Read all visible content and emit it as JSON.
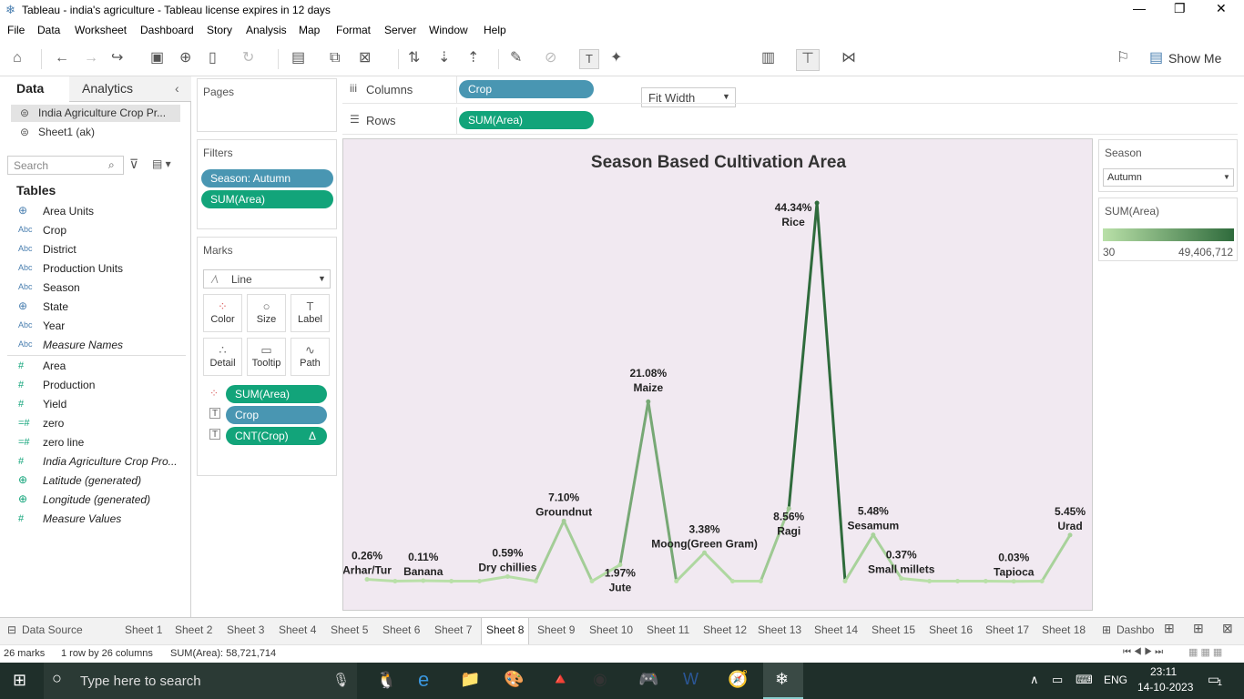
{
  "window": {
    "title": "Tableau - india's agriculture - Tableau license expires in 12 days"
  },
  "menu": [
    "File",
    "Data",
    "Worksheet",
    "Dashboard",
    "Story",
    "Analysis",
    "Map",
    "Format",
    "Server",
    "Window",
    "Help"
  ],
  "toolbar": {
    "fit": "Fit Width",
    "show_me": "Show Me"
  },
  "data_pane": {
    "tab_data": "Data",
    "tab_analytics": "Analytics",
    "sources": [
      "India Agriculture Crop Pr...",
      "Sheet1 (ak)"
    ],
    "search_placeholder": "Search",
    "tables_heading": "Tables",
    "fields": [
      {
        "type": "globe",
        "name": "Area Units"
      },
      {
        "type": "Abc",
        "name": "Crop"
      },
      {
        "type": "Abc",
        "name": "District"
      },
      {
        "type": "Abc",
        "name": "Production Units"
      },
      {
        "type": "Abc",
        "name": "Season"
      },
      {
        "type": "globe",
        "name": "State"
      },
      {
        "type": "Abc",
        "name": "Year"
      },
      {
        "type": "Abc",
        "name": "Measure Names"
      },
      {
        "type": "#",
        "name": "Area"
      },
      {
        "type": "#",
        "name": "Production"
      },
      {
        "type": "#",
        "name": "Yield"
      },
      {
        "type": "=#",
        "name": "zero"
      },
      {
        "type": "=#",
        "name": "zero line"
      },
      {
        "type": "#",
        "name": "India Agriculture Crop Pro..."
      },
      {
        "type": "globe",
        "name": "Latitude (generated)"
      },
      {
        "type": "globe",
        "name": "Longitude (generated)"
      },
      {
        "type": "#",
        "name": "Measure Values"
      }
    ]
  },
  "pages": {
    "title": "Pages"
  },
  "filters": {
    "title": "Filters",
    "items": [
      "Season: Autumn",
      "SUM(Area)"
    ]
  },
  "marks": {
    "title": "Marks",
    "type": "Line",
    "buttons": [
      "Color",
      "Size",
      "Label",
      "Detail",
      "Tooltip",
      "Path"
    ],
    "pills": [
      "SUM(Area)",
      "Crop",
      "CNT(Crop)"
    ],
    "delta": "Δ"
  },
  "shelves": {
    "columns_label": "Columns",
    "columns_pill": "Crop",
    "rows_label": "Rows",
    "rows_pill": "SUM(Area)"
  },
  "season_card": {
    "title": "Season",
    "value": "Autumn"
  },
  "legend": {
    "title": "SUM(Area)",
    "min": "30",
    "max": "49,406,712"
  },
  "chart_data": {
    "type": "line",
    "title": "Season Based Cultivation  Area",
    "points": [
      {
        "label": "Arhar/Tur",
        "pct": "0.26%",
        "value": 0.26
      },
      {
        "label": "",
        "pct": "",
        "value": 0.05
      },
      {
        "label": "Banana",
        "pct": "0.11%",
        "value": 0.11
      },
      {
        "label": "",
        "pct": "",
        "value": 0.05
      },
      {
        "label": "",
        "pct": "",
        "value": 0.05
      },
      {
        "label": "Dry chillies",
        "pct": "0.59%",
        "value": 0.59
      },
      {
        "label": "",
        "pct": "",
        "value": 0.05
      },
      {
        "label": "Groundnut",
        "pct": "7.10%",
        "value": 7.1
      },
      {
        "label": "",
        "pct": "",
        "value": 0.05
      },
      {
        "label": "Jute",
        "pct": "1.97%",
        "value": 1.97
      },
      {
        "label": "Maize",
        "pct": "21.08%",
        "value": 21.08
      },
      {
        "label": "",
        "pct": "",
        "value": 0.05
      },
      {
        "label": "Moong(Green Gram)",
        "pct": "3.38%",
        "value": 3.38
      },
      {
        "label": "",
        "pct": "",
        "value": 0.05
      },
      {
        "label": "",
        "pct": "",
        "value": 0.05
      },
      {
        "label": "Ragi",
        "pct": "8.56%",
        "value": 8.56
      },
      {
        "label": "Rice",
        "pct": "44.34%",
        "value": 44.34
      },
      {
        "label": "",
        "pct": "",
        "value": 0.05
      },
      {
        "label": "Sesamum",
        "pct": "5.48%",
        "value": 5.48
      },
      {
        "label": "Small millets",
        "pct": "0.37%",
        "value": 0.37
      },
      {
        "label": "",
        "pct": "",
        "value": 0.05
      },
      {
        "label": "",
        "pct": "",
        "value": 0.05
      },
      {
        "label": "",
        "pct": "",
        "value": 0.05
      },
      {
        "label": "Tapioca",
        "pct": "0.03%",
        "value": 0.03
      },
      {
        "label": "",
        "pct": "",
        "value": 0.05
      },
      {
        "label": "Urad",
        "pct": "5.45%",
        "value": 5.45
      }
    ]
  },
  "sheet_tabs": [
    "Data Source",
    "Sheet 1",
    "Sheet 2",
    "Sheet 3",
    "Sheet 4",
    "Sheet 5",
    "Sheet 6",
    "Sheet 7",
    "Sheet 8",
    "Sheet 9",
    "Sheet 10",
    "Sheet 11",
    "Sheet 12",
    "Sheet 13",
    "Sheet 14",
    "Sheet 15",
    "Sheet 16",
    "Sheet 17",
    "Sheet 18",
    "Dashbo"
  ],
  "active_sheet": "Sheet 8",
  "status": {
    "marks": "26 marks",
    "rows": "1 row by 26 columns",
    "sum": "SUM(Area): 58,721,714"
  },
  "taskbar": {
    "search_placeholder": "Type here to search",
    "lang": "ENG",
    "time": "23:11",
    "date": "14-10-2023",
    "notif": "1"
  }
}
